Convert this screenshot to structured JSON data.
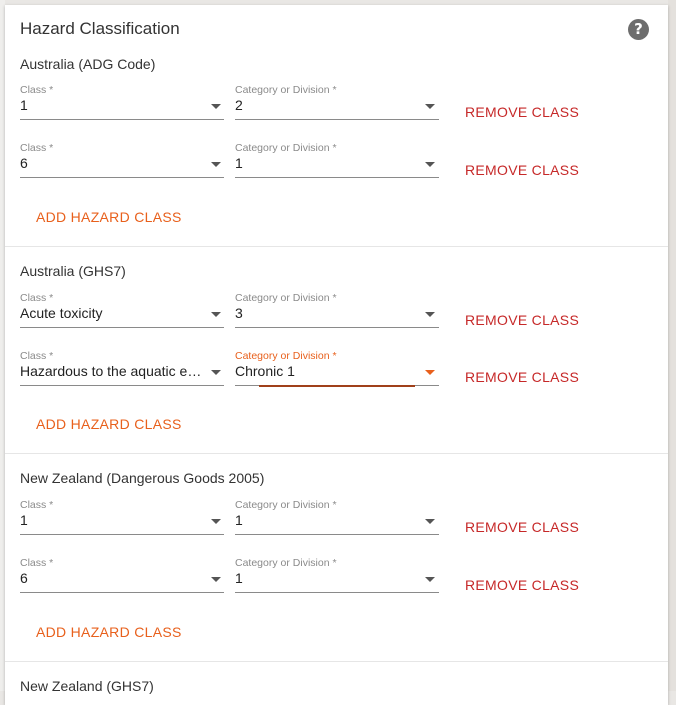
{
  "panel": {
    "title": "Hazard Classification",
    "help_icon": "?"
  },
  "labels": {
    "class": "Class *",
    "category": "Category or Division *",
    "remove": "REMOVE CLASS",
    "add": "ADD HAZARD CLASS"
  },
  "sections": [
    {
      "title": "Australia (ADG Code)",
      "rows": [
        {
          "class": "1",
          "category": "2"
        },
        {
          "class": "6",
          "category": "1"
        }
      ]
    },
    {
      "title": "Australia (GHS7)",
      "rows": [
        {
          "class": "Acute toxicity",
          "category": "3"
        },
        {
          "class": "Hazardous to the aquatic environment",
          "category": "Chronic 1"
        }
      ]
    },
    {
      "title": "New Zealand (Dangerous Goods 2005)",
      "rows": [
        {
          "class": "1",
          "category": "1"
        },
        {
          "class": "6",
          "category": "1"
        }
      ]
    },
    {
      "title": "New Zealand (GHS7)"
    }
  ],
  "colors": {
    "accent": "#e8601c",
    "remove": "#c62828",
    "focus_underline": "#a0401a"
  }
}
